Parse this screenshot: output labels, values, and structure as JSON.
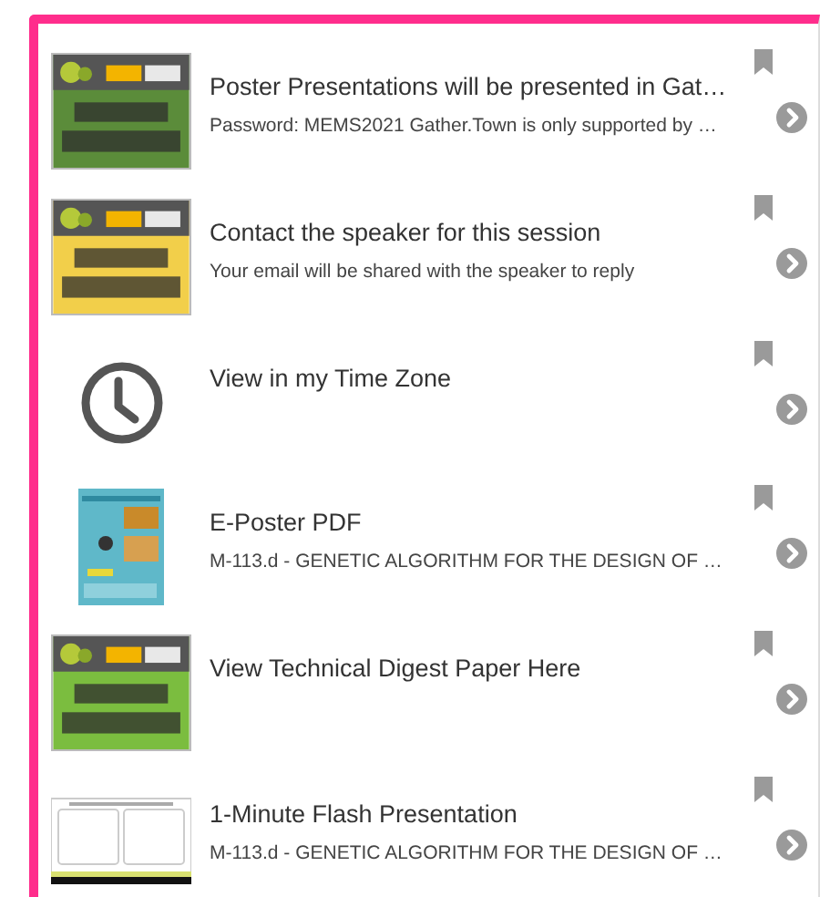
{
  "items": [
    {
      "thumbnail": {
        "kind": "banner",
        "color": "#5b8c3a"
      },
      "title": "Poster Presentations will be presented in Gat…",
      "subtitle": "Password: MEMS2021 Gather.Town is only supported by …"
    },
    {
      "thumbnail": {
        "kind": "banner",
        "color": "#f2cf4a"
      },
      "title": "Contact the speaker for this session",
      "subtitle": "Your email will be shared with the speaker to reply"
    },
    {
      "thumbnail": {
        "kind": "clock"
      },
      "title": "View in my Time Zone"
    },
    {
      "thumbnail": {
        "kind": "poster"
      },
      "title": "E-Poster PDF",
      "subtitle": "M-113.d - GENETIC ALGORITHM FOR THE DESIGN OF …"
    },
    {
      "thumbnail": {
        "kind": "banner",
        "color": "#7bbd3f"
      },
      "title": "View Technical Digest Paper Here"
    },
    {
      "thumbnail": {
        "kind": "slide"
      },
      "title": "1-Minute Flash Presentation",
      "subtitle": "M-113.d - GENETIC ALGORITHM FOR THE DESIGN OF …"
    }
  ]
}
